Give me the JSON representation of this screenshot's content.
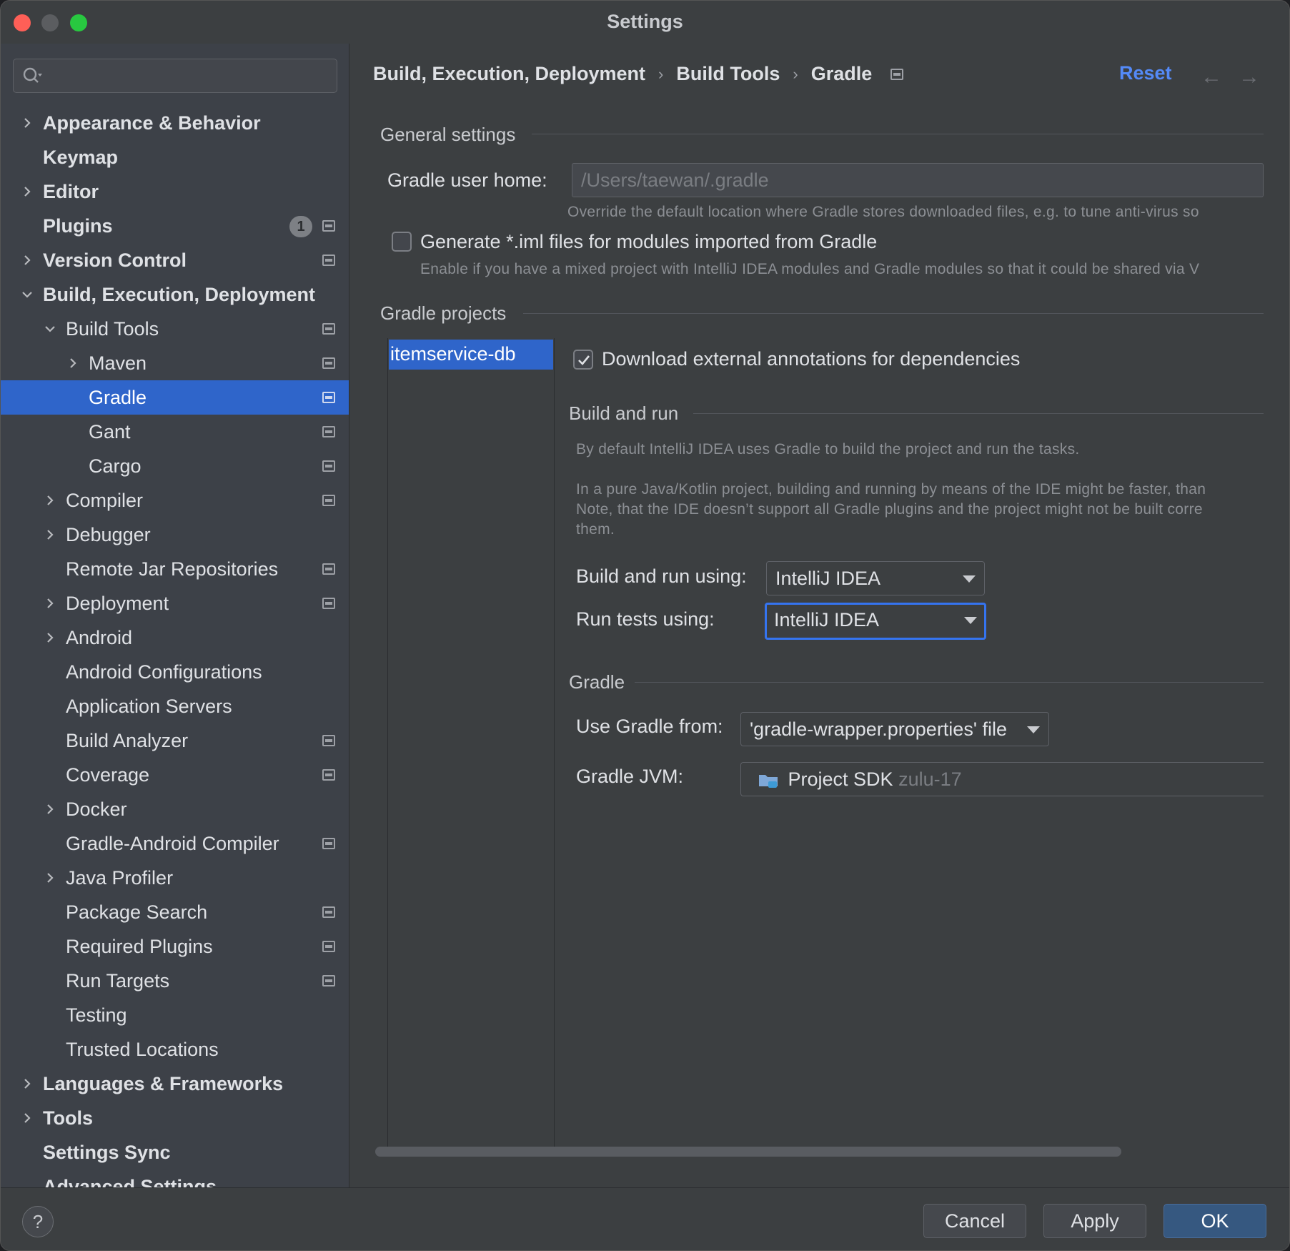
{
  "window": {
    "title": "Settings"
  },
  "search": {
    "placeholder": ""
  },
  "sidebar": {
    "items": [
      {
        "label": "Appearance & Behavior",
        "bold": true,
        "chevron": "right",
        "level": 0
      },
      {
        "label": "Keymap",
        "bold": true,
        "chevron": "",
        "level": 0
      },
      {
        "label": "Editor",
        "bold": true,
        "chevron": "right",
        "level": 0
      },
      {
        "label": "Plugins",
        "bold": true,
        "chevron": "",
        "level": 0,
        "badge": "1",
        "projIcon": true
      },
      {
        "label": "Version Control",
        "bold": true,
        "chevron": "right",
        "level": 0,
        "projIcon": true
      },
      {
        "label": "Build, Execution, Deployment",
        "bold": true,
        "chevron": "down",
        "level": 0
      },
      {
        "label": "Build Tools",
        "chevron": "down",
        "level": 1,
        "projIcon": true
      },
      {
        "label": "Maven",
        "chevron": "right",
        "level": 2,
        "projIcon": true
      },
      {
        "label": "Gradle",
        "chevron": "",
        "level": 2,
        "projIcon": true,
        "selected": true
      },
      {
        "label": "Gant",
        "chevron": "",
        "level": 2,
        "projIcon": true
      },
      {
        "label": "Cargo",
        "chevron": "",
        "level": 2,
        "projIcon": true
      },
      {
        "label": "Compiler",
        "chevron": "right",
        "level": 1,
        "projIcon": true
      },
      {
        "label": "Debugger",
        "chevron": "right",
        "level": 1
      },
      {
        "label": "Remote Jar Repositories",
        "chevron": "",
        "level": 1,
        "projIcon": true
      },
      {
        "label": "Deployment",
        "chevron": "right",
        "level": 1,
        "projIcon": true
      },
      {
        "label": "Android",
        "chevron": "right",
        "level": 1
      },
      {
        "label": "Android Configurations",
        "chevron": "",
        "level": 1
      },
      {
        "label": "Application Servers",
        "chevron": "",
        "level": 1
      },
      {
        "label": "Build Analyzer",
        "chevron": "",
        "level": 1,
        "projIcon": true
      },
      {
        "label": "Coverage",
        "chevron": "",
        "level": 1,
        "projIcon": true
      },
      {
        "label": "Docker",
        "chevron": "right",
        "level": 1
      },
      {
        "label": "Gradle-Android Compiler",
        "chevron": "",
        "level": 1,
        "projIcon": true
      },
      {
        "label": "Java Profiler",
        "chevron": "right",
        "level": 1
      },
      {
        "label": "Package Search",
        "chevron": "",
        "level": 1,
        "projIcon": true
      },
      {
        "label": "Required Plugins",
        "chevron": "",
        "level": 1,
        "projIcon": true
      },
      {
        "label": "Run Targets",
        "chevron": "",
        "level": 1,
        "projIcon": true
      },
      {
        "label": "Testing",
        "chevron": "",
        "level": 1
      },
      {
        "label": "Trusted Locations",
        "chevron": "",
        "level": 1
      },
      {
        "label": "Languages & Frameworks",
        "bold": true,
        "chevron": "right",
        "level": 0
      },
      {
        "label": "Tools",
        "bold": true,
        "chevron": "right",
        "level": 0
      },
      {
        "label": "Settings Sync",
        "bold": true,
        "chevron": "",
        "level": 0
      },
      {
        "label": "Advanced Settings",
        "bold": true,
        "chevron": "",
        "level": 0
      }
    ]
  },
  "breadcrumb": {
    "part1": "Build, Execution, Deployment",
    "part2": "Build Tools",
    "part3": "Gradle",
    "sep": "›"
  },
  "header": {
    "reset": "Reset",
    "back": "←",
    "forward": "→"
  },
  "general": {
    "title": "General settings",
    "user_home_label": "Gradle user home:",
    "user_home_placeholder": "/Users/taewan/.gradle",
    "user_home_hint": "Override the default location where Gradle stores downloaded files, e.g. to tune anti-virus so",
    "iml_label": "Generate *.iml files for modules imported from Gradle",
    "iml_checked": false,
    "iml_hint": "Enable if you have a mixed project with IntelliJ IDEA modules and Gradle modules so that it could be shared via V"
  },
  "projects": {
    "title": "Gradle projects",
    "items": [
      "itemservice-db"
    ],
    "annotations_label": "Download external annotations for dependencies",
    "annotations_checked": true
  },
  "build_run": {
    "title": "Build and run",
    "desc1": "By default IntelliJ IDEA uses Gradle to build the project and run the tasks.",
    "desc2": "In a pure Java/Kotlin project, building and running by means of the IDE might be faster, than",
    "desc3": "Note, that the IDE doesn’t support all Gradle plugins and the project might not be built corre",
    "desc4": "them.",
    "build_using_label": "Build and run using:",
    "build_using_value": "IntelliJ IDEA",
    "tests_using_label": "Run tests using:",
    "tests_using_value": "IntelliJ IDEA"
  },
  "gradle": {
    "title": "Gradle",
    "use_from_label": "Use Gradle from:",
    "use_from_value": "'gradle-wrapper.properties' file",
    "jvm_label": "Gradle JVM:",
    "jvm_value": "Project SDK",
    "jvm_detail": "zulu-17"
  },
  "footer": {
    "help": "?",
    "cancel": "Cancel",
    "apply": "Apply",
    "ok": "OK"
  },
  "colors": {
    "accent": "#2f65ca",
    "link": "#548af7",
    "close": "#fe5f57",
    "maximize": "#28c840"
  }
}
